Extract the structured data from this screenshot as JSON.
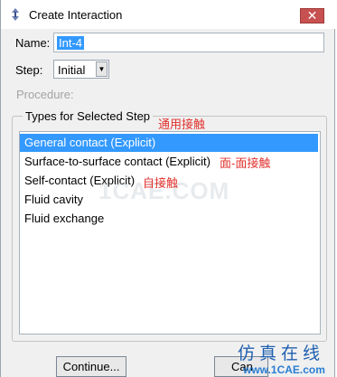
{
  "window": {
    "title": "Create Interaction",
    "close_glyph": "✕"
  },
  "form": {
    "name_label": "Name:",
    "name_value": "Int-4",
    "step_label": "Step:",
    "step_value": "Initial",
    "procedure_label": "Procedure:"
  },
  "types": {
    "group_title": "Types for Selected Step",
    "items": [
      {
        "label": "General contact (Explicit)",
        "selected": true
      },
      {
        "label": "Surface-to-surface contact (Explicit)",
        "selected": false
      },
      {
        "label": "Self-contact (Explicit)",
        "selected": false
      },
      {
        "label": "Fluid cavity",
        "selected": false
      },
      {
        "label": "Fluid exchange",
        "selected": false
      }
    ]
  },
  "annotations": {
    "general": "通用接触",
    "surface": "面-面接触",
    "self": "自接触"
  },
  "buttons": {
    "continue": "Continue...",
    "cancel": "Can"
  },
  "watermark": {
    "center": "1CAE.COM",
    "chinese": "仿真在线",
    "url": "www.1CAE.com"
  },
  "colors": {
    "selection": "#3399ff",
    "annotation": "#e0322e",
    "close": "#c75050"
  }
}
